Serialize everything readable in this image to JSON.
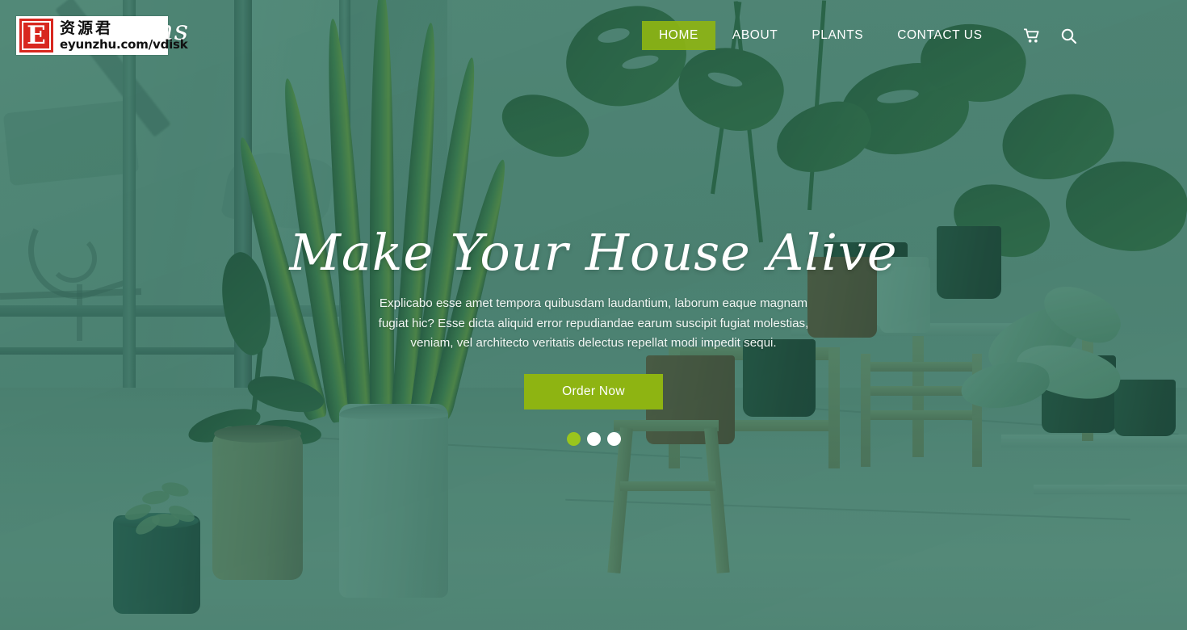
{
  "site": {
    "brand": "Plant Paths",
    "brand_visible_fragment": "aths"
  },
  "header": {
    "nav": [
      {
        "label": "HOME",
        "active": true
      },
      {
        "label": "ABOUT",
        "active": false
      },
      {
        "label": "PLANTS",
        "active": false
      },
      {
        "label": "CONTACT US",
        "active": false
      }
    ],
    "icons": [
      {
        "name": "cart-icon"
      },
      {
        "name": "search-icon"
      }
    ]
  },
  "hero": {
    "title": "Make Your House Alive",
    "description": "Explicabo esse amet tempora quibusdam laudantium, laborum eaque magnam fugiat hic? Esse dicta aliquid error repudiandae earum suscipit fugiat molestias, veniam, vel architecto veritatis delectus repellat modi impedit sequi.",
    "cta_label": "Order Now",
    "slider": {
      "total": 3,
      "active_index": 0
    }
  },
  "watermark": {
    "badge_letter": "E",
    "chinese_text": "资源君",
    "url": "eyunzhu.com/vdisk"
  },
  "colors": {
    "accent_green": "#8eb412",
    "accent_dot_active": "#9ac51d",
    "overlay_teal": "#3c826e",
    "text_white": "#ffffff",
    "watermark_red": "#d8271f"
  }
}
